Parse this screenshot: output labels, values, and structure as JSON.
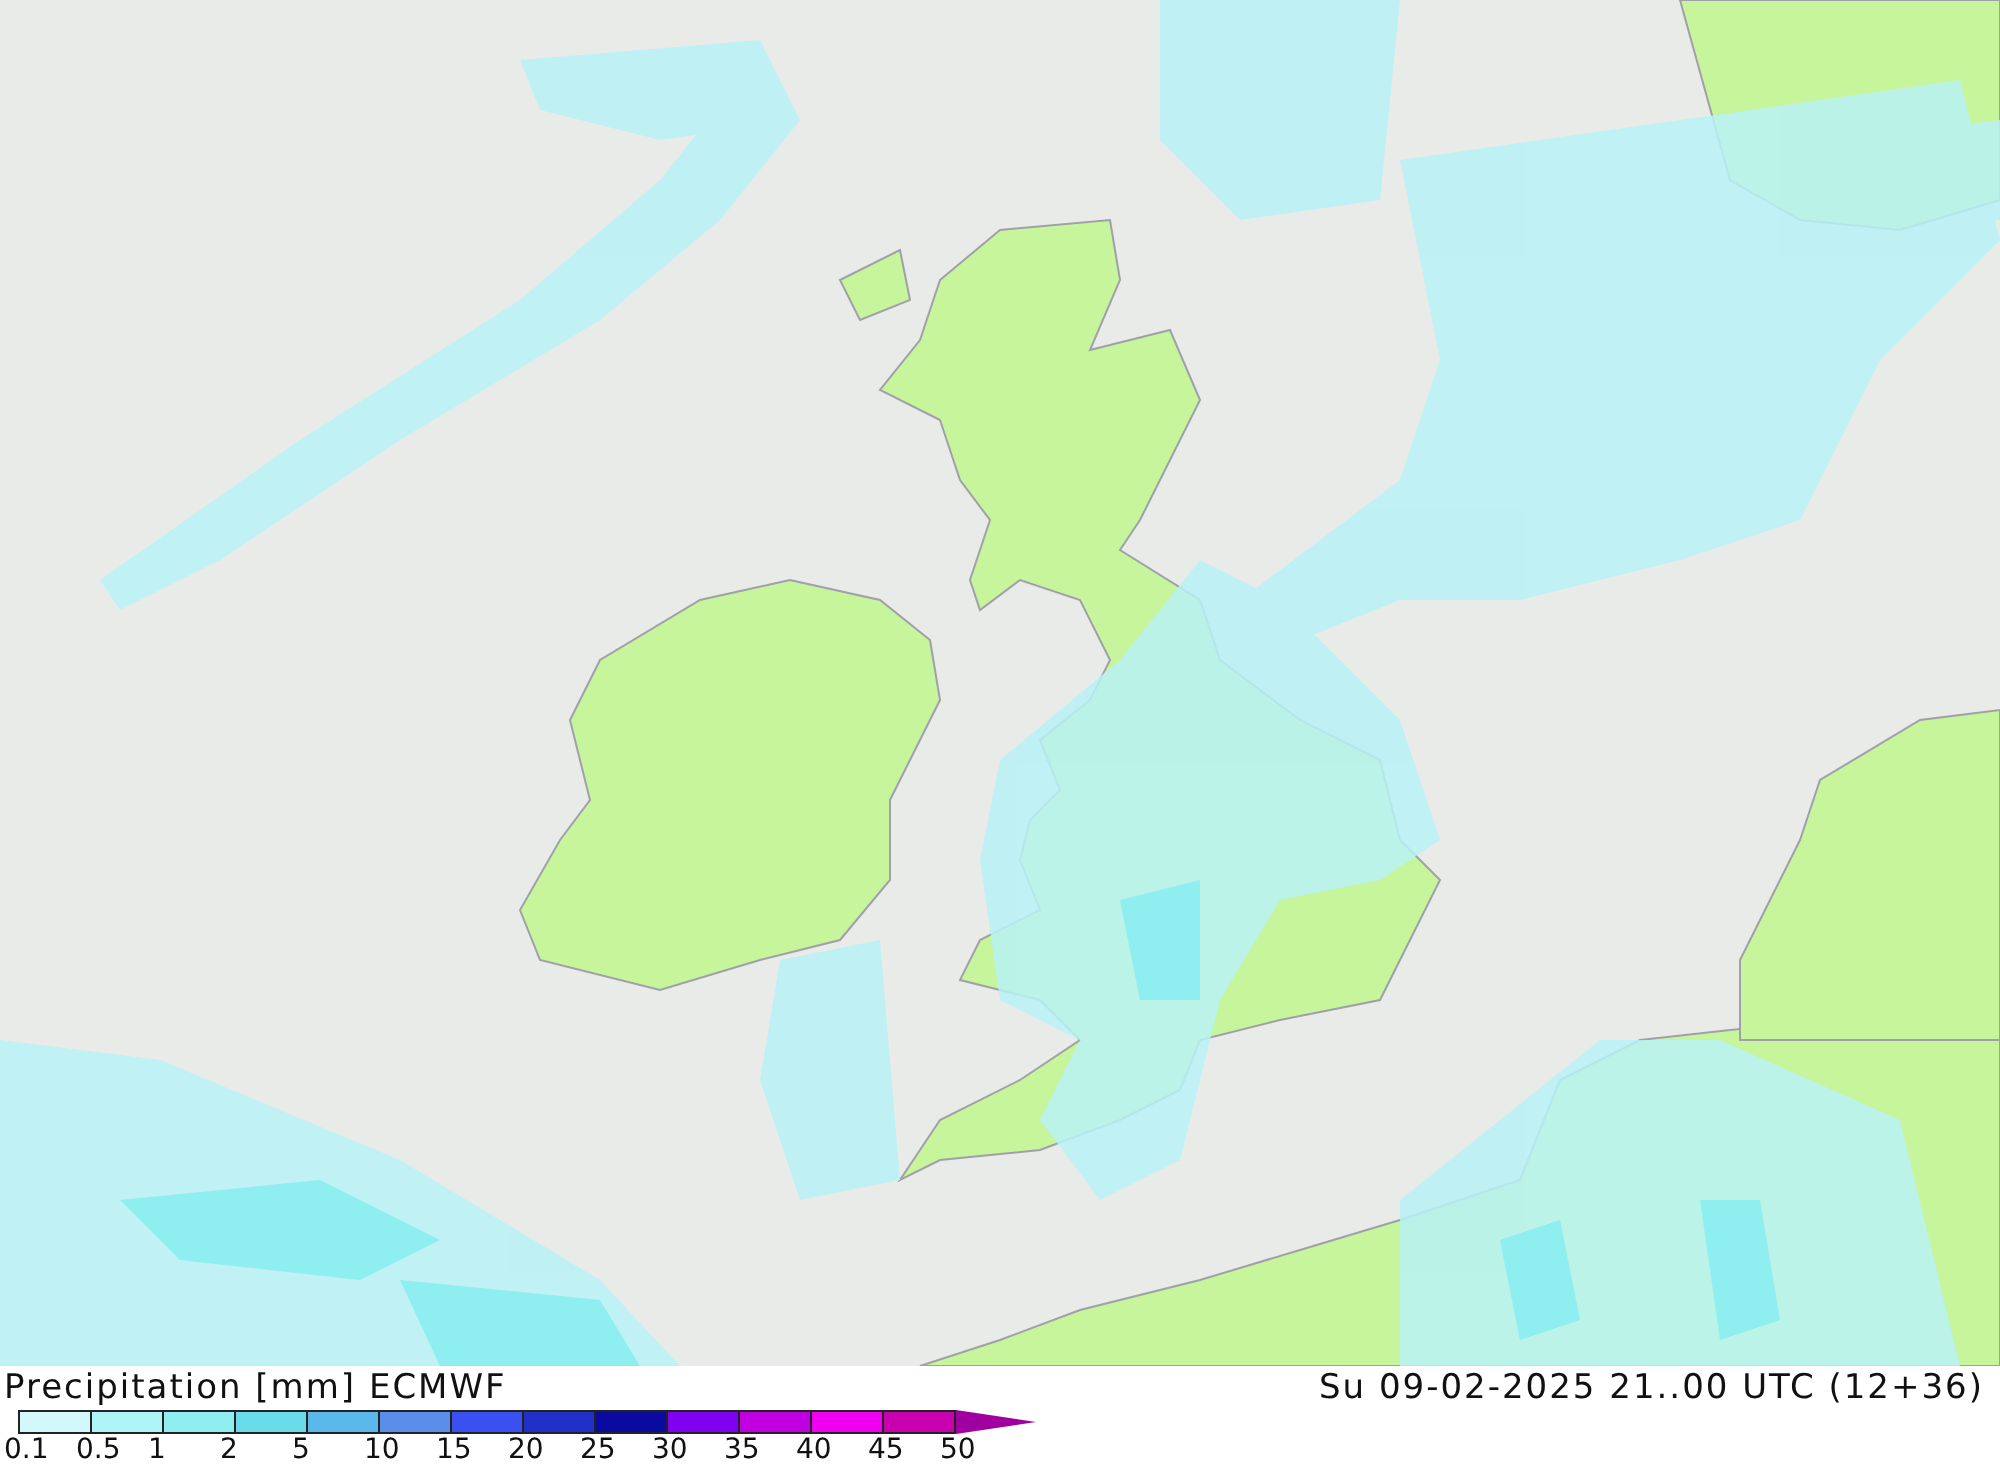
{
  "map": {
    "title": "Precipitation [mm] ECMWF",
    "valid_time": "Su 09-02-2025 21..00 UTC (12+36)"
  },
  "legend": {
    "bins": [
      {
        "color": "#d2f8fb"
      },
      {
        "color": "#aef5f8"
      },
      {
        "color": "#8eeef0"
      },
      {
        "color": "#6adbe8"
      },
      {
        "color": "#5ab8ea"
      },
      {
        "color": "#5a8eea"
      },
      {
        "color": "#3a50f0"
      },
      {
        "color": "#2030c8"
      },
      {
        "color": "#0a0aa0"
      },
      {
        "color": "#8000f0"
      },
      {
        "color": "#c000e0"
      },
      {
        "color": "#f000f0"
      },
      {
        "color": "#c800b0"
      }
    ],
    "overflow": {
      "color": "#a000a0"
    },
    "labels": [
      "0.1",
      "0.5",
      "1",
      "2",
      "5",
      "10",
      "15",
      "20",
      "25",
      "30",
      "35",
      "40",
      "45",
      "50"
    ]
  }
}
